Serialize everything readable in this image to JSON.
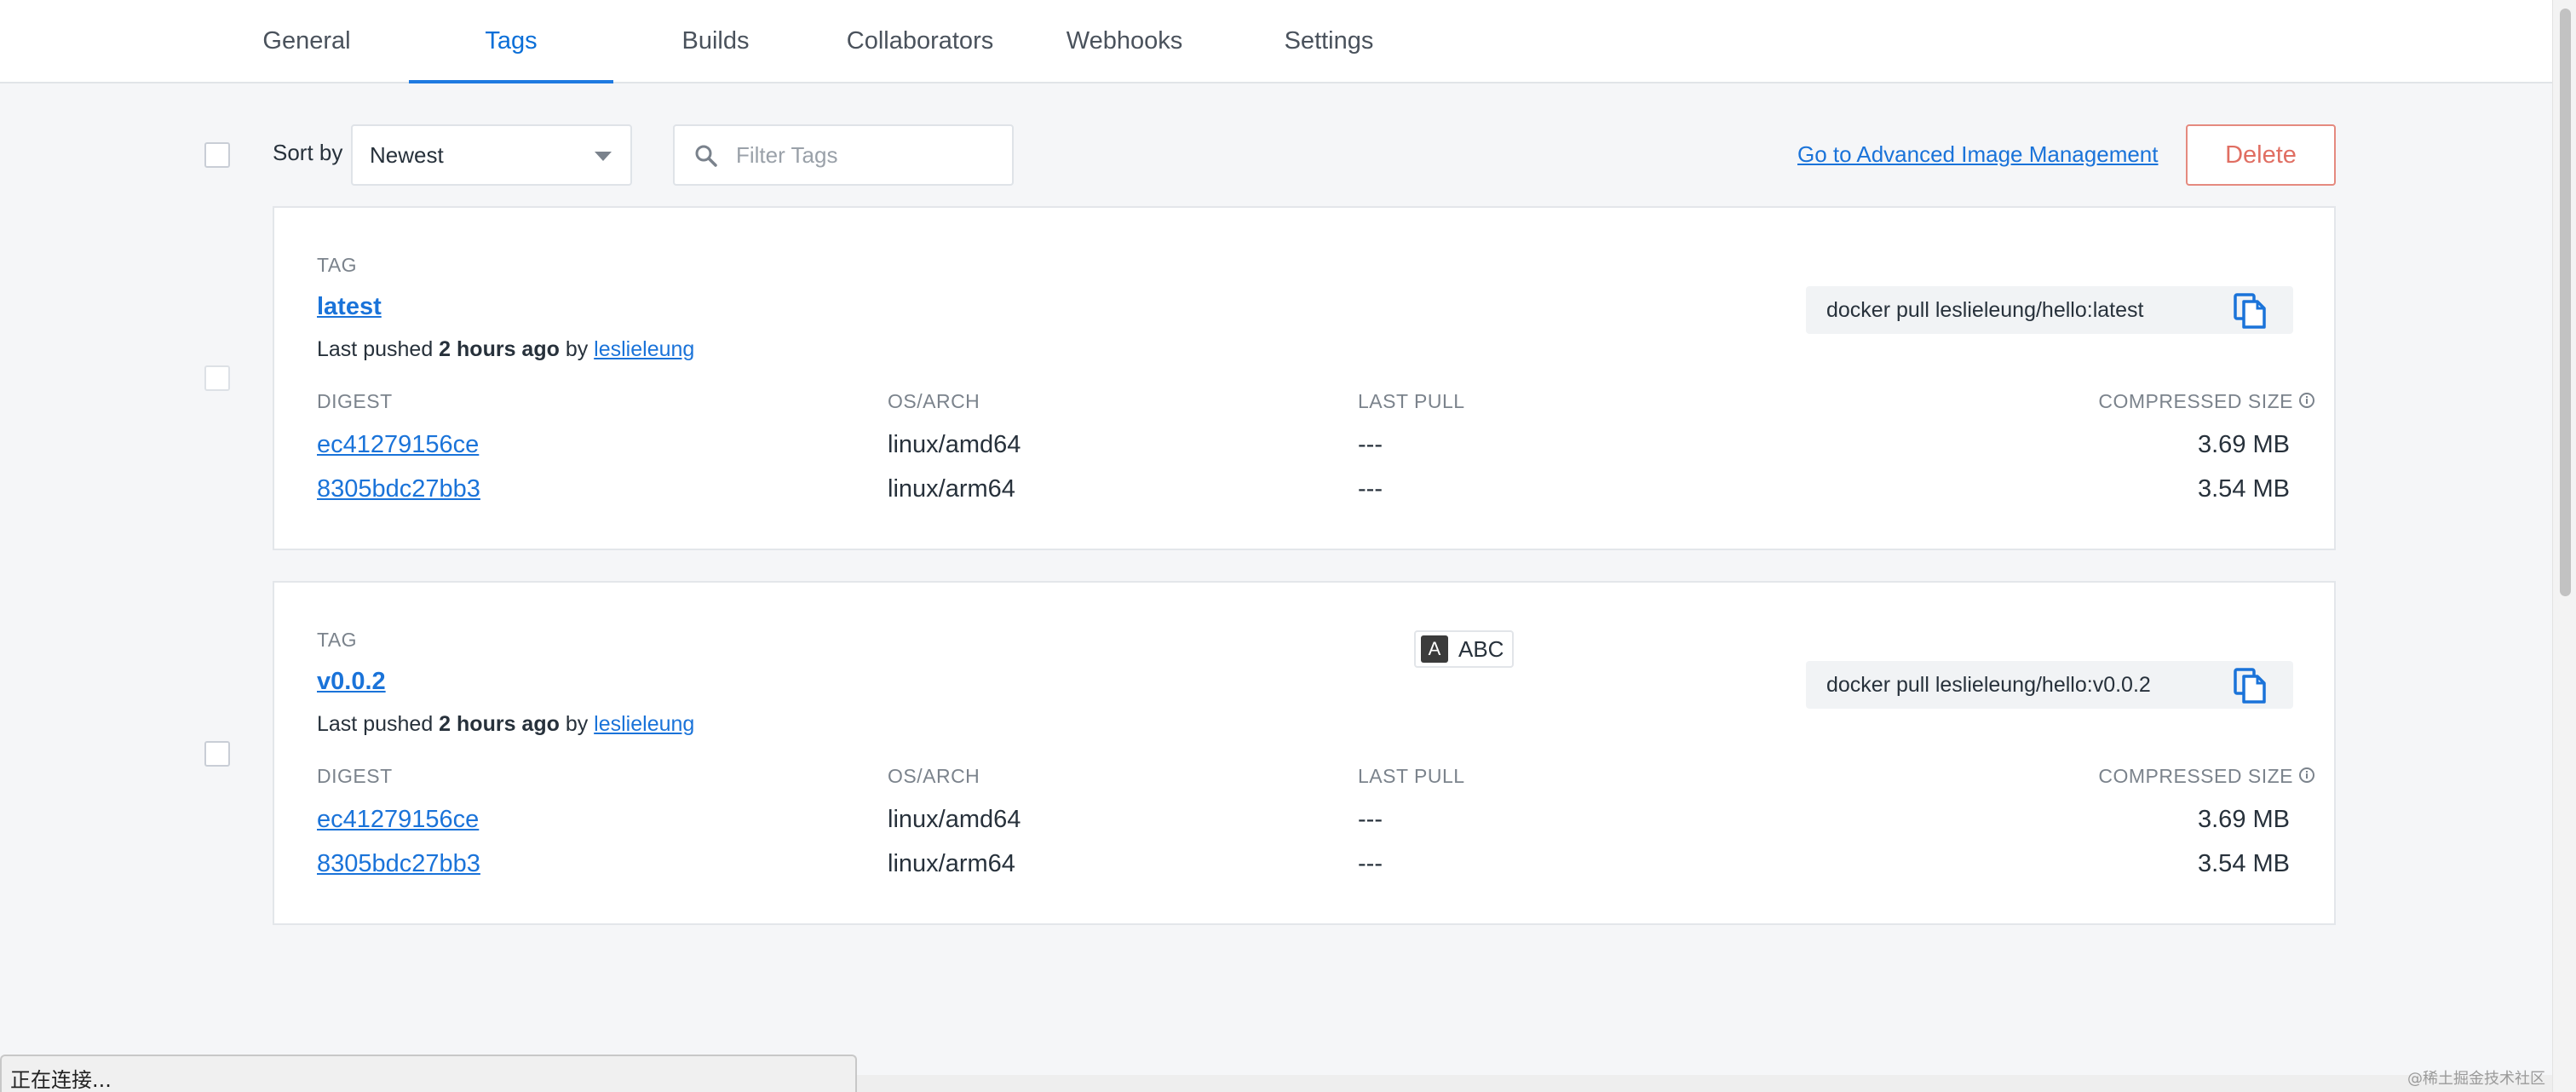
{
  "tabs": [
    {
      "label": "General",
      "active": false
    },
    {
      "label": "Tags",
      "active": true
    },
    {
      "label": "Builds",
      "active": false
    },
    {
      "label": "Collaborators",
      "active": false
    },
    {
      "label": "Webhooks",
      "active": false
    },
    {
      "label": "Settings",
      "active": false
    }
  ],
  "toolbar": {
    "sort_label": "Sort by",
    "sort_value": "Newest",
    "filter_placeholder": "Filter Tags",
    "advanced_link": "Go to Advanced Image Management",
    "delete_label": "Delete"
  },
  "columns": {
    "tag": "TAG",
    "digest": "DIGEST",
    "os_arch": "OS/ARCH",
    "last_pull": "LAST PULL",
    "compressed_size": "COMPRESSED SIZE"
  },
  "tags": [
    {
      "name": "latest",
      "pushed_prefix": "Last pushed",
      "pushed_time": "2 hours ago",
      "pushed_by_word": "by",
      "pushed_by": "leslieleung",
      "pull_command": "docker pull leslieleung/hello:latest",
      "images": [
        {
          "digest": "ec41279156ce",
          "os_arch": "linux/amd64",
          "last_pull": "---",
          "size": "3.69 MB"
        },
        {
          "digest": "8305bdc27bb3",
          "os_arch": "linux/arm64",
          "last_pull": "---",
          "size": "3.54 MB"
        }
      ]
    },
    {
      "name": "v0.0.2",
      "pushed_prefix": "Last pushed",
      "pushed_time": "2 hours ago",
      "pushed_by_word": "by",
      "pushed_by": "leslieleung",
      "pull_command": "docker pull leslieleung/hello:v0.0.2",
      "images": [
        {
          "digest": "ec41279156ce",
          "os_arch": "linux/amd64",
          "last_pull": "---",
          "size": "3.69 MB"
        },
        {
          "digest": "8305bdc27bb3",
          "os_arch": "linux/arm64",
          "last_pull": "---",
          "size": "3.54 MB"
        }
      ]
    }
  ],
  "ime_badge": {
    "letter": "A",
    "text": "ABC"
  },
  "status_bar": "正在连接...",
  "watermark": "@稀土掘金技术社区",
  "colors": {
    "accent": "#1f7ae0",
    "link": "#1a73d9",
    "danger": "#e06e62"
  }
}
